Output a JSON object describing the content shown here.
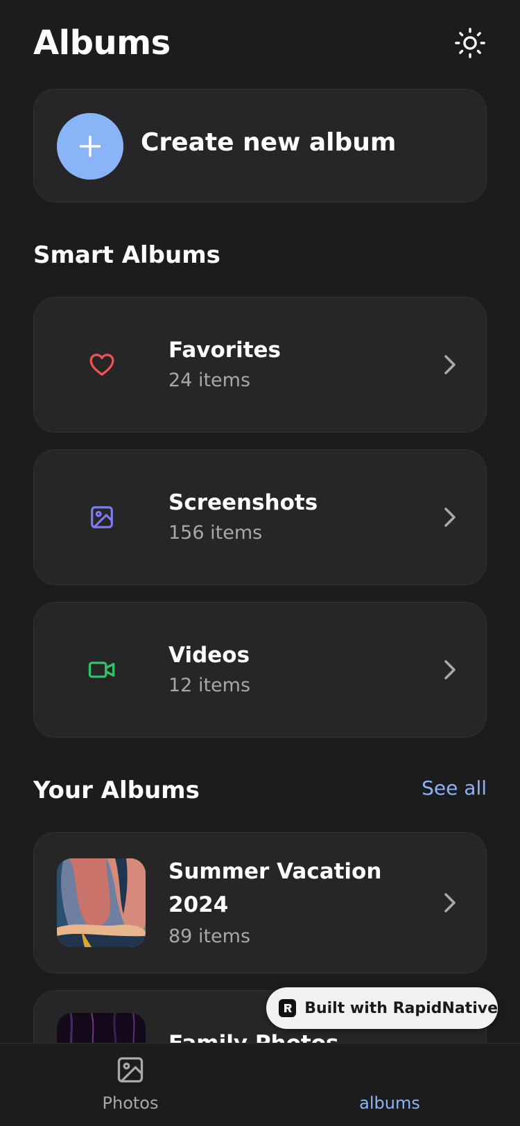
{
  "header": {
    "title": "Albums",
    "theme_icon": "sun-icon"
  },
  "create_album": {
    "label": "Create new album",
    "icon": "plus-icon",
    "accent": "#8ab4f8"
  },
  "smart_albums": {
    "title": "Smart Albums",
    "items": [
      {
        "name": "Favorites",
        "count": "24 items",
        "icon": "heart-icon",
        "color": "#f05252"
      },
      {
        "name": "Screenshots",
        "count": "156 items",
        "icon": "image-icon",
        "color": "#7c7cf0"
      },
      {
        "name": "Videos",
        "count": "12 items",
        "icon": "video-icon",
        "color": "#2fc46b"
      }
    ]
  },
  "your_albums": {
    "title": "Your Albums",
    "see_all": "See all",
    "items": [
      {
        "name_line1": "Summer Vacation",
        "name_line2": "2024",
        "count": "89 items"
      },
      {
        "name_line1": "Family Photos"
      }
    ]
  },
  "badge": {
    "label": "Built with RapidNative"
  },
  "tabbar": {
    "tabs": [
      {
        "label": "Photos",
        "icon": "photo-icon",
        "active": false
      },
      {
        "label": "albums",
        "active": true
      }
    ],
    "active_color": "#8ab4f8",
    "inactive_color": "#a8a8a8"
  }
}
